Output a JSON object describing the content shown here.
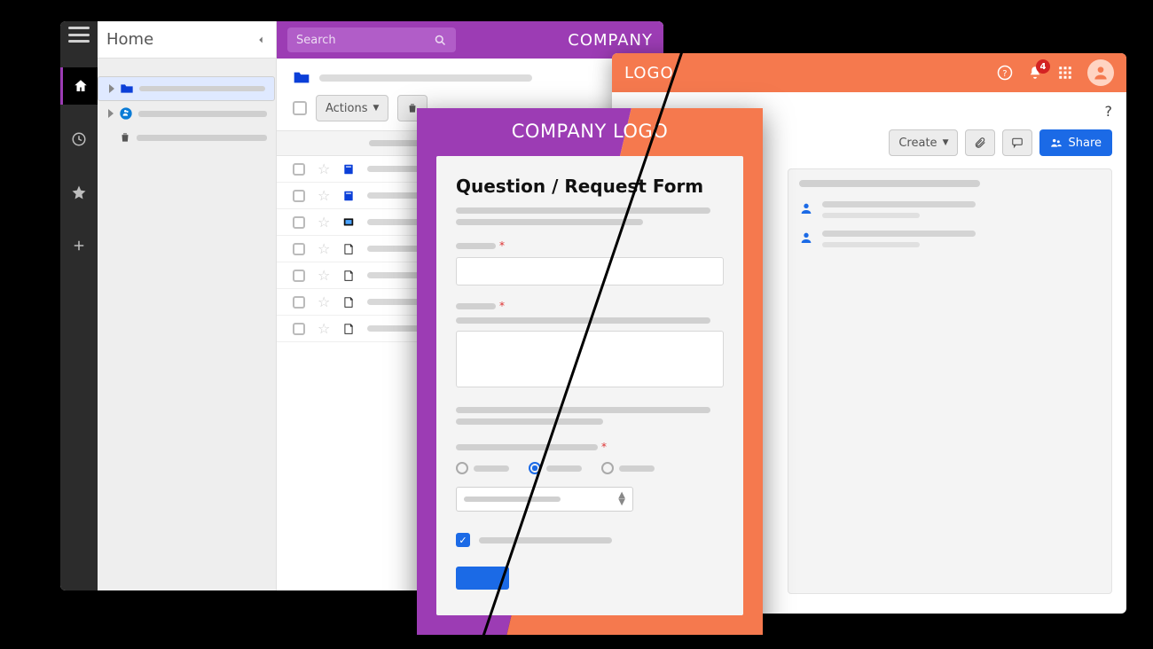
{
  "left_app": {
    "home_label": "Home",
    "search_placeholder": "Search",
    "brand": "COMPANY",
    "actions_label": "Actions",
    "rail": [
      "menu",
      "home",
      "clock",
      "star",
      "plus"
    ],
    "tree_items": [
      {
        "icon": "folder",
        "selected": true
      },
      {
        "icon": "people",
        "selected": false
      },
      {
        "icon": "trash",
        "selected": false
      }
    ],
    "file_rows": 7
  },
  "right_app": {
    "brand": "LOGO",
    "notification_count": "4",
    "create_label": "Create",
    "share_label": "Share",
    "members": 2
  },
  "modal": {
    "brand": "COMPANY LOGO",
    "title": "Question / Request Form",
    "radio_selected_index": 1,
    "checkbox_checked": true
  }
}
